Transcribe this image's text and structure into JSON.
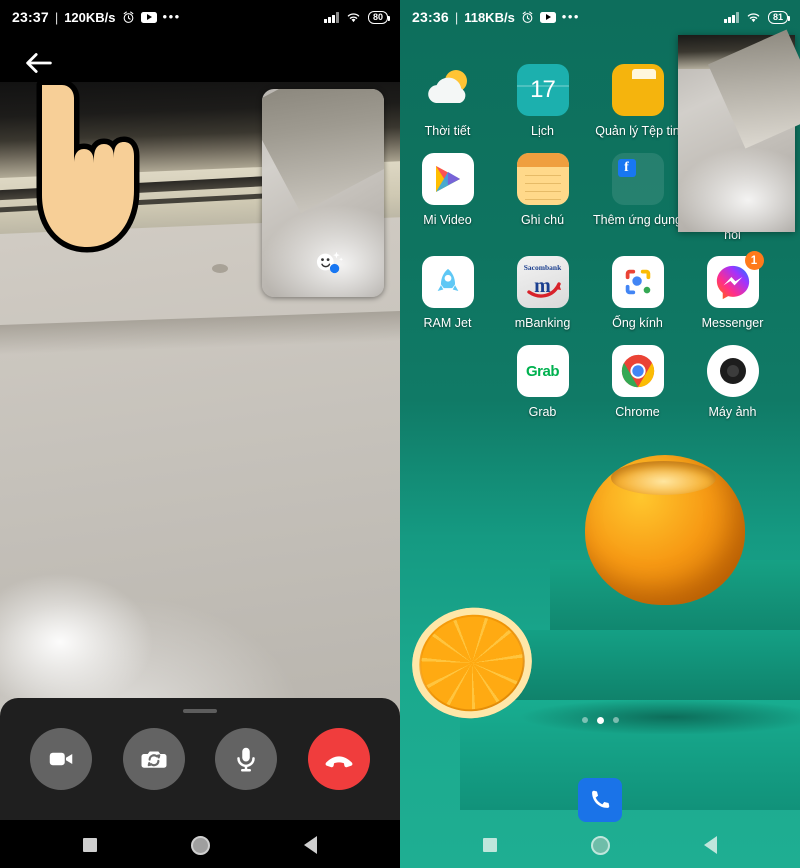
{
  "left_screen": {
    "name": "messenger-video-call",
    "status_bar": {
      "time": "23:37",
      "separator": "|",
      "network_speed": "120KB/s",
      "icons": [
        "alarm-icon",
        "youtube-icon",
        "more-dots-icon"
      ],
      "signal": "signal-icon",
      "wifi": "wifi-icon",
      "battery_level": "80"
    },
    "back_button_label": "back-arrow",
    "self_view_label": "self-view-preview",
    "effects_label": "effects-icon",
    "cursor_label": "tap-hand-pointer",
    "controls": [
      {
        "name": "video-toggle-button",
        "icon": "video-camera-icon"
      },
      {
        "name": "switch-camera-button",
        "icon": "camera-flip-icon"
      },
      {
        "name": "mute-button",
        "icon": "microphone-icon"
      },
      {
        "name": "end-call-button",
        "icon": "end-call-icon"
      }
    ],
    "nav_bar": [
      {
        "name": "recents-button",
        "icon": "square-icon"
      },
      {
        "name": "home-button",
        "icon": "circle-icon"
      },
      {
        "name": "back-button",
        "icon": "triangle-icon"
      }
    ]
  },
  "right_screen": {
    "name": "android-home-screen",
    "status_bar": {
      "time": "23:36",
      "separator": "|",
      "network_speed": "118KB/s",
      "icons": [
        "alarm-icon",
        "youtube-icon",
        "more-dots-icon"
      ],
      "signal": "signal-icon",
      "wifi": "wifi-icon",
      "battery_level": "81"
    },
    "app_rows": [
      [
        {
          "label": "Thời tiết",
          "icon": "weather-icon",
          "badge": ""
        },
        {
          "label": "Lịch",
          "icon": "calendar-icon",
          "date": "17",
          "badge": ""
        },
        {
          "label": "Quản lý Tệp tin",
          "icon": "file-manager-icon",
          "badge": ""
        },
        {
          "label": "",
          "icon": "",
          "badge": ""
        }
      ],
      [
        {
          "label": "Mi Video",
          "icon": "mi-video-icon",
          "badge": ""
        },
        {
          "label": "Ghi chú",
          "icon": "notes-icon",
          "badge": ""
        },
        {
          "label": "Thêm ứng dụng",
          "icon": "facebook-folder-icon",
          "badge": ""
        },
        {
          "label": "Dịch vụ & phản hồi",
          "icon": "services-feedback-icon",
          "badge": ""
        }
      ],
      [
        {
          "label": "RAM Jet",
          "icon": "ram-jet-icon",
          "badge": ""
        },
        {
          "label": "mBanking",
          "icon": "sacombank-icon",
          "bank_name": "Sacombank",
          "bank_mark": "m",
          "badge": ""
        },
        {
          "label": "Ống kính",
          "icon": "google-lens-icon",
          "badge": ""
        },
        {
          "label": "Messenger",
          "icon": "messenger-icon",
          "badge": "1"
        }
      ],
      [
        {
          "label": "",
          "icon": "",
          "badge": ""
        },
        {
          "label": "Grab",
          "icon": "grab-icon",
          "wordmark": "Grab",
          "badge": ""
        },
        {
          "label": "Chrome",
          "icon": "chrome-icon",
          "badge": ""
        },
        {
          "label": "Máy ảnh",
          "icon": "camera-icon",
          "badge": ""
        }
      ]
    ],
    "page_indicator": {
      "total": 3,
      "active": 2
    },
    "dock": [
      {
        "name": "phone-dock-icon",
        "label": "phone-icon"
      }
    ],
    "floating_window_label": "floating-video-window",
    "nav_bar": [
      {
        "name": "recents-button",
        "icon": "square-icon"
      },
      {
        "name": "home-button",
        "icon": "circle-icon"
      },
      {
        "name": "back-button",
        "icon": "triangle-icon"
      }
    ]
  },
  "colors": {
    "home_bg": "#0f7a64",
    "accent_teal": "#1cb0ae",
    "end_call_red": "#f03d3d",
    "badge_orange": "#ff7a1a",
    "dock_blue": "#1a73e8"
  }
}
